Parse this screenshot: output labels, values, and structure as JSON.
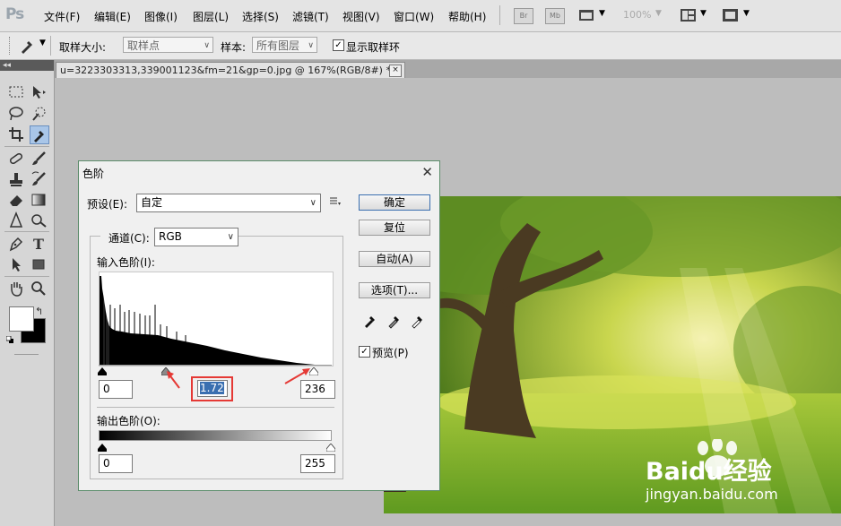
{
  "app": {
    "logo": "Ps"
  },
  "menubar": {
    "items": [
      "文件(F)",
      "编辑(E)",
      "图像(I)",
      "图层(L)",
      "选择(S)",
      "滤镜(T)",
      "视图(V)",
      "窗口(W)",
      "帮助(H)"
    ],
    "zoom": "100%",
    "br_label": "Br",
    "mb_label": "Mb"
  },
  "options": {
    "sample_size_label": "取样大小:",
    "sample_size_value": "取样点",
    "sample_label": "样本:",
    "sample_value": "所有图层",
    "show_ring_label": "显示取样环",
    "show_ring_checked": true
  },
  "document": {
    "tab_title": "u=3223303313,339001123&fm=21&gp=0.jpg @ 167%(RGB/8#) *",
    "close_glyph": "×"
  },
  "dialog": {
    "title": "色阶",
    "close_glyph": "✕",
    "preset_label": "预设(E):",
    "preset_value": "自定",
    "channel_label": "通道(C):",
    "channel_value": "RGB",
    "input_levels_label": "输入色阶(I):",
    "output_levels_label": "输出色阶(O):",
    "input_black": "0",
    "input_gamma": "1.72",
    "input_white": "236",
    "output_black": "0",
    "output_white": "255",
    "buttons": {
      "ok": "确定",
      "reset": "复位",
      "auto": "自动(A)",
      "options": "选项(T)..."
    },
    "preview_label": "预览(P)",
    "preview_checked": true
  },
  "watermark": {
    "brand": "Baidu经验",
    "url": "jingyan.baidu.com"
  },
  "colors": {
    "accent_highlight": "#3a6fb0",
    "annotation_red": "#e53935"
  }
}
